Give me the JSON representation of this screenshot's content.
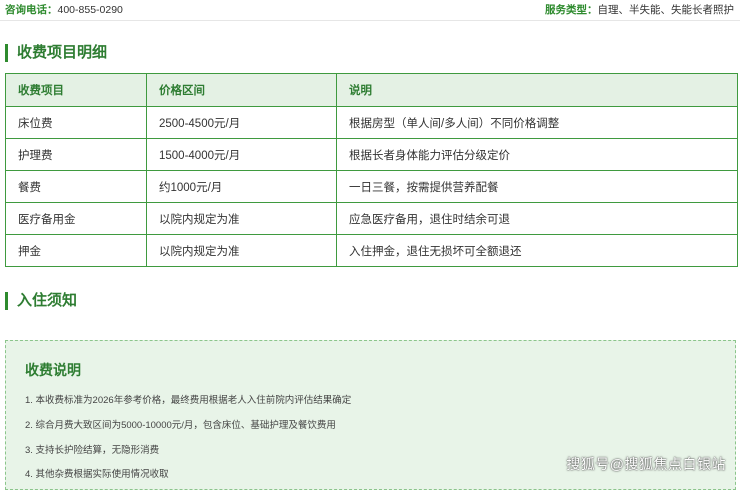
{
  "topbar": {
    "phone_label": "咨询电话：",
    "phone_value": "400-855-0290",
    "service_label": "服务类型：",
    "service_value": "自理、半失能、失能长者照护"
  },
  "fee_section": {
    "title": "收费项目明细",
    "headers": [
      "收费项目",
      "价格区间",
      "说明"
    ],
    "rows": [
      {
        "item": "床位费",
        "price": "2500-4500元/月",
        "note": "根据房型（单人间/多人间）不同价格调整"
      },
      {
        "item": "护理费",
        "price": "1500-4000元/月",
        "note": "根据长者身体能力评估分级定价"
      },
      {
        "item": "餐费",
        "price": "约1000元/月",
        "note": "一日三餐，按需提供营养配餐"
      },
      {
        "item": "医疗备用金",
        "price": "以院内规定为准",
        "note": "应急医疗备用，退住时结余可退"
      },
      {
        "item": "押金",
        "price": "以院内规定为准",
        "note": "入住押金，退住无损坏可全额退还"
      }
    ]
  },
  "admission_section": {
    "title": "入住须知"
  },
  "notes": {
    "title": "收费说明",
    "items": [
      "1. 本收费标准为2026年参考价格，最终费用根据老人入住前院内评估结果确定",
      "2. 综合月费大致区间为5000-10000元/月，包含床位、基础护理及餐饮费用",
      "3. 支持长护险结算，无隐形消费",
      "4. 其他杂费根据实际使用情况收取"
    ]
  },
  "watermark": "搜狐号@搜狐焦点白银站",
  "colors": {
    "accent": "#2e7d32",
    "border": "#3f9a3f",
    "header_bg": "#e4f1e4",
    "notes_bg": "#e8f4e8"
  }
}
